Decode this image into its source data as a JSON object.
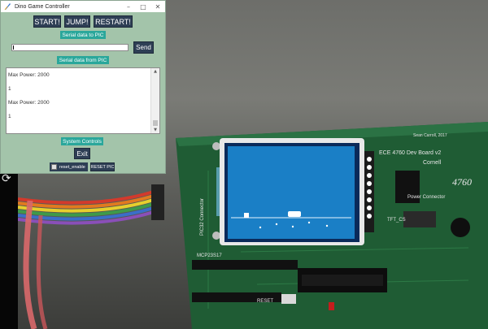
{
  "window": {
    "title": "Dino Game Controller",
    "minimize": "–",
    "maximize": "□",
    "close": "✕"
  },
  "controls": {
    "start": "START!",
    "jump": "JUMP!",
    "restart": "RESTART!"
  },
  "serial_to_pic": {
    "label": "Serial data to PIC",
    "input_value": "",
    "send": "Send"
  },
  "serial_from_pic": {
    "label": "Serial data from PIC",
    "lines": [
      "Max Power: 2000",
      "1",
      "Max Power: 2000",
      "1"
    ]
  },
  "system_controls": {
    "label": "System Controls",
    "exit": "Exit",
    "reset_enable": "reset_enable",
    "reset_enable_checked": false,
    "reset_pic": "RESET PIC"
  },
  "board": {
    "silkscreen_title": "ECE 4760 Dev Board v2",
    "silkscreen_sub": "Cornell",
    "signature": "Sean Carroll, 2017",
    "sticker": "4760",
    "power_connector": "Power Connector",
    "pic_connector": "PIC32 Connector",
    "tft_label": "TFT_CS",
    "mcp_label": "MCP23S17",
    "reset_label": "RESET"
  },
  "colors": {
    "window_bg": "#a3c4aa",
    "dark_button": "#2e3f55",
    "teal_label": "#2aa79b",
    "pcb_green": "#1f5c34",
    "tft_blue": "#1a7fc6"
  },
  "icons": {
    "rotate": "rotate-icon",
    "app": "feather-app-icon"
  }
}
